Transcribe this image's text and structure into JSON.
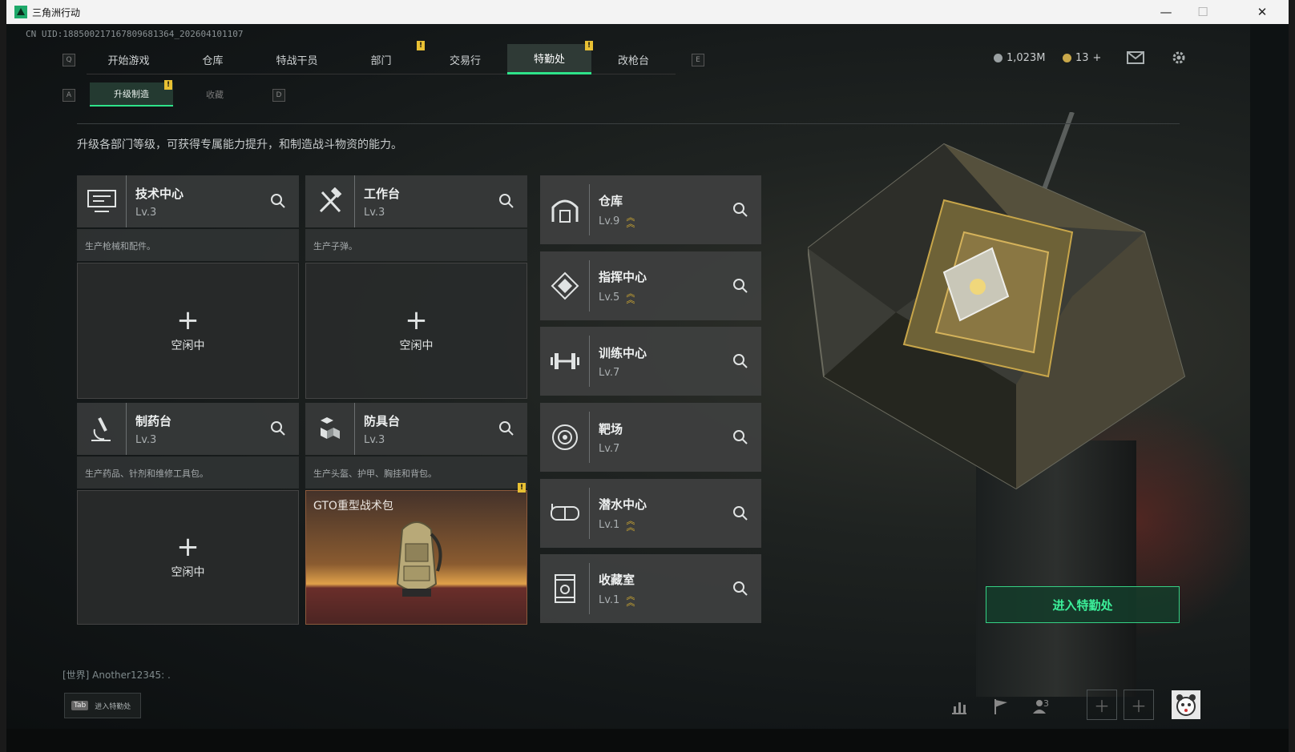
{
  "window": {
    "title": "三角洲行动",
    "min": "—",
    "max": "☐",
    "close": "✕"
  },
  "uid": "CN UID:1885002171678096813​64_202604101107",
  "nav": {
    "key_left": "Q",
    "key_right": "E",
    "tabs": [
      {
        "label": "开始游戏"
      },
      {
        "label": "仓库"
      },
      {
        "label": "特战干员"
      },
      {
        "label": "部门"
      },
      {
        "label": "交易行"
      },
      {
        "label": "特勤处"
      },
      {
        "label": "改枪台"
      }
    ],
    "badge": "!"
  },
  "subnav": {
    "key_left": "A",
    "key_right": "D",
    "tabs": [
      {
        "label": "升级制造"
      },
      {
        "label": "收藏"
      }
    ]
  },
  "currency": {
    "money": "1,023M",
    "coins": "13",
    "coins_plus": "+"
  },
  "description": "升级各部门等级，可获得专属能力提升，和制造战斗物资的能力。",
  "workbenches": [
    {
      "name": "技术中心",
      "level": "Lv.3",
      "desc": "生产枪械和配件。",
      "plus": "+",
      "status": "空闲中"
    },
    {
      "name": "工作台",
      "level": "Lv.3",
      "desc": "生产子弹。",
      "plus": "+",
      "status": "空闲中"
    },
    {
      "name": "制药台",
      "level": "Lv.3",
      "desc": "生产药品、针剂和维修工具包。",
      "plus": "+",
      "status": "空闲中"
    },
    {
      "name": "防具台",
      "level": "Lv.3",
      "desc": "生产头盔、护甲、胸挂和背包。",
      "crafting": "GTO重型战术包"
    }
  ],
  "facilities": [
    {
      "name": "仓库",
      "level": "Lv.9",
      "upgrade": true
    },
    {
      "name": "指挥中心",
      "level": "Lv.5",
      "upgrade": true
    },
    {
      "name": "训练中心",
      "level": "Lv.7",
      "upgrade": false
    },
    {
      "name": "靶场",
      "level": "Lv.7",
      "upgrade": false
    },
    {
      "name": "潜水中心",
      "level": "Lv.1",
      "upgrade": true
    },
    {
      "name": "收藏室",
      "level": "Lv.1",
      "upgrade": true
    }
  ],
  "enter_button": "进入特勤处",
  "chat": "[世界] Another12345: .",
  "tab_hint": {
    "key": "Tab",
    "label": "进入特勤处"
  },
  "friends_count": "3",
  "colors": {
    "accent": "#2ee38a",
    "badge": "#e8c033",
    "upgrade_chevron": "#e2b730"
  },
  "icons": [
    "settings-gear-icon",
    "mail-icon",
    "search-icon",
    "stats-icon",
    "flag-icon",
    "friends-icon"
  ]
}
